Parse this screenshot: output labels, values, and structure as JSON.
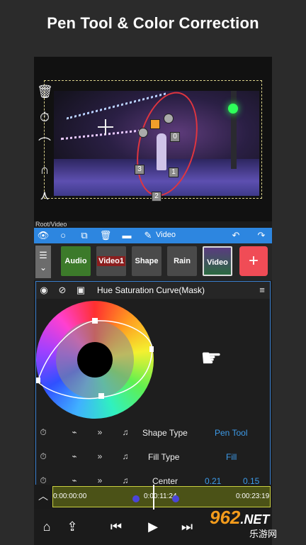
{
  "banner": {
    "title": "Pen Tool & Color Correction"
  },
  "preview": {
    "root_label": "Root/Video",
    "handles": [
      "0",
      "3",
      "1",
      "2"
    ]
  },
  "toolbar": {
    "label": "Video",
    "icons": [
      "eye-icon",
      "circle-icon",
      "copy-icon",
      "trash-icon",
      "folder-icon",
      "pen-icon",
      "undo-icon",
      "redo-icon"
    ]
  },
  "layers": {
    "items": [
      "Audio",
      "Video1",
      "Shape",
      "Rain",
      "Video"
    ],
    "add_label": "+"
  },
  "panel": {
    "title": "Hue Saturation Curve(Mask)",
    "rows": [
      {
        "label": "Shape Type",
        "value": "Pen Tool"
      },
      {
        "label": "Fill Type",
        "value": "Fill"
      },
      {
        "label": "Center",
        "value_1": "0.21",
        "value_2": "0.15"
      }
    ]
  },
  "timeline": {
    "start": "0:00:00:00",
    "current": "0:00:11:24",
    "end": "0:00:23:19"
  },
  "watermark": {
    "logo": "962",
    "suffix": ".NET",
    "sub": "乐游网"
  },
  "colors": {
    "accent": "#2d86e0",
    "value_blue": "#3d9be9",
    "add_red": "#f04c56",
    "mask_red": "#e0353f"
  }
}
